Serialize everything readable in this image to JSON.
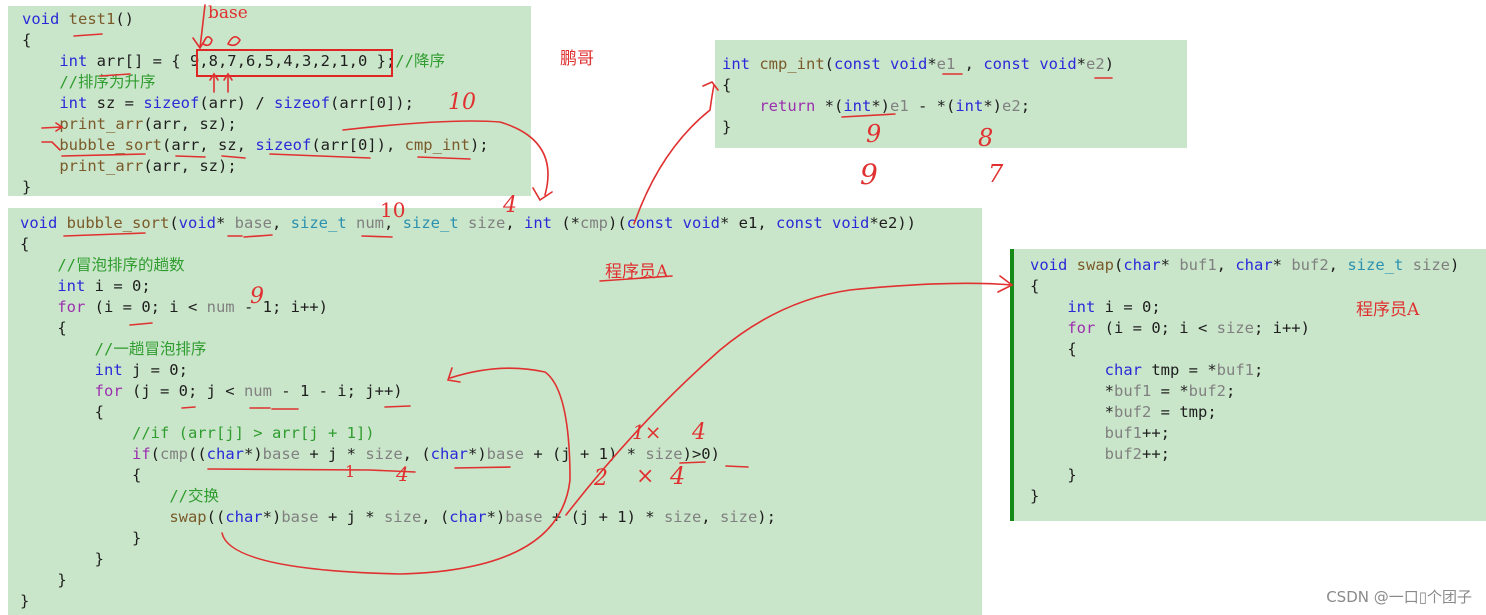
{
  "panels": {
    "test1": {
      "lines": [
        [
          [
            "kw",
            "void "
          ],
          [
            "fn",
            "test1"
          ],
          [
            "",
            "()"
          ]
        ],
        [
          [
            "",
            "{"
          ]
        ],
        [
          [
            "",
            "    "
          ],
          [
            "kw",
            "int "
          ],
          [
            "",
            "arr[] = { 9,8,7,6,5,4,3,2,1,0 };"
          ],
          [
            "cm",
            "//降序"
          ]
        ],
        [
          [
            "",
            "    "
          ],
          [
            "cm",
            "//排序为升序"
          ]
        ],
        [
          [
            "",
            "    "
          ],
          [
            "kw",
            "int "
          ],
          [
            "",
            "sz = "
          ],
          [
            "kw",
            "sizeof"
          ],
          [
            "",
            "(arr) / "
          ],
          [
            "kw",
            "sizeof"
          ],
          [
            "",
            "(arr[0]);"
          ]
        ],
        [
          [
            "",
            "    "
          ],
          [
            "fn",
            "print_arr"
          ],
          [
            "",
            "(arr, sz);"
          ]
        ],
        [
          [
            "",
            "    "
          ],
          [
            "fn",
            "bubble_sort"
          ],
          [
            "",
            "(arr, sz, "
          ],
          [
            "kw",
            "sizeof"
          ],
          [
            "",
            "(arr[0]), "
          ],
          [
            "fn",
            "cmp_int"
          ],
          [
            "",
            ");"
          ]
        ],
        [
          [
            "",
            "    "
          ],
          [
            "fn",
            "print_arr"
          ],
          [
            "",
            "(arr, sz);"
          ]
        ],
        [
          [
            "",
            "}"
          ]
        ]
      ]
    },
    "cmp_int": {
      "lines": [
        [
          [
            "kw",
            "int "
          ],
          [
            "fn",
            "cmp_int"
          ],
          [
            "",
            "("
          ],
          [
            "kw",
            "const void"
          ],
          [
            "",
            "*"
          ],
          [
            "par",
            "e1"
          ],
          [
            "",
            " , "
          ],
          [
            "kw",
            "const void"
          ],
          [
            "",
            "*"
          ],
          [
            "par",
            "e2"
          ],
          [
            "",
            ")"
          ]
        ],
        [
          [
            "",
            "{"
          ]
        ],
        [
          [
            "",
            "    "
          ],
          [
            "ret",
            "return "
          ],
          [
            "",
            "*("
          ],
          [
            "kw",
            "int"
          ],
          [
            "",
            "*)"
          ],
          [
            "par",
            "e1"
          ],
          [
            "",
            " - *("
          ],
          [
            "kw",
            "int"
          ],
          [
            "",
            "*)"
          ],
          [
            "par",
            "e2"
          ],
          [
            "",
            ";"
          ]
        ],
        [
          [
            "",
            "}"
          ]
        ]
      ]
    },
    "bubble_sort": {
      "lines": [
        [
          [
            "kw",
            "void "
          ],
          [
            "fn",
            "bubble_sort"
          ],
          [
            "",
            "("
          ],
          [
            "kw",
            "void"
          ],
          [
            "",
            "* "
          ],
          [
            "par",
            "base"
          ],
          [
            "",
            ", "
          ],
          [
            "ty",
            "size_t "
          ],
          [
            "par",
            "num"
          ],
          [
            "",
            ", "
          ],
          [
            "ty",
            "size_t "
          ],
          [
            "par",
            "size"
          ],
          [
            "",
            ", "
          ],
          [
            "kw",
            "int "
          ],
          [
            "",
            "(*"
          ],
          [
            "par",
            "cmp"
          ],
          [
            "",
            ")("
          ],
          [
            "kw",
            "const void"
          ],
          [
            "",
            "* e1, "
          ],
          [
            "kw",
            "const void"
          ],
          [
            "",
            "*e2))"
          ]
        ],
        [
          [
            "",
            "{"
          ]
        ],
        [
          [
            "",
            "    "
          ],
          [
            "cm",
            "//冒泡排序的趟数"
          ]
        ],
        [
          [
            "",
            "    "
          ],
          [
            "kw",
            "int "
          ],
          [
            "",
            "i = 0;"
          ]
        ],
        [
          [
            "",
            "    "
          ],
          [
            "ctl",
            "for "
          ],
          [
            "",
            "(i = 0; i < "
          ],
          [
            "par",
            "num"
          ],
          [
            "",
            " - 1; i++)"
          ]
        ],
        [
          [
            "",
            "    {"
          ]
        ],
        [
          [
            "",
            "        "
          ],
          [
            "cm",
            "//一趟冒泡排序"
          ]
        ],
        [
          [
            "",
            "        "
          ],
          [
            "kw",
            "int "
          ],
          [
            "",
            "j = 0;"
          ]
        ],
        [
          [
            "",
            "        "
          ],
          [
            "ctl",
            "for "
          ],
          [
            "",
            "(j = 0; j < "
          ],
          [
            "par",
            "num"
          ],
          [
            "",
            " - 1 - i; j++)"
          ]
        ],
        [
          [
            "",
            "        {"
          ]
        ],
        [
          [
            "",
            "            "
          ],
          [
            "cm",
            "//if (arr[j] > arr[j + 1])"
          ]
        ],
        [
          [
            "",
            "            "
          ],
          [
            "ctl",
            "if"
          ],
          [
            "",
            "("
          ],
          [
            "par",
            "cmp"
          ],
          [
            "",
            "(("
          ],
          [
            "kw",
            "char"
          ],
          [
            "",
            "*)"
          ],
          [
            "par",
            "base"
          ],
          [
            "",
            " + j * "
          ],
          [
            "par",
            "size"
          ],
          [
            "",
            ", ("
          ],
          [
            "kw",
            "char"
          ],
          [
            "",
            "*)"
          ],
          [
            "par",
            "base"
          ],
          [
            "",
            " + (j + 1) * "
          ],
          [
            "par",
            "size"
          ],
          [
            "",
            ")>0)"
          ]
        ],
        [
          [
            "",
            "            {"
          ]
        ],
        [
          [
            "",
            "                "
          ],
          [
            "cm",
            "//交换"
          ]
        ],
        [
          [
            "",
            "                "
          ],
          [
            "fn",
            "swap"
          ],
          [
            "",
            "(("
          ],
          [
            "kw",
            "char"
          ],
          [
            "",
            "*)"
          ],
          [
            "par",
            "base"
          ],
          [
            "",
            " + j * "
          ],
          [
            "par",
            "size"
          ],
          [
            "",
            ", ("
          ],
          [
            "kw",
            "char"
          ],
          [
            "",
            "*)"
          ],
          [
            "par",
            "base"
          ],
          [
            "",
            " + (j + 1) * "
          ],
          [
            "par",
            "size"
          ],
          [
            "",
            ", "
          ],
          [
            "par",
            "size"
          ],
          [
            "",
            ");"
          ]
        ],
        [
          [
            "",
            "            }"
          ]
        ],
        [
          [
            "",
            "        }"
          ]
        ],
        [
          [
            "",
            "    }"
          ]
        ],
        [
          [
            "",
            "}"
          ]
        ]
      ]
    },
    "swap": {
      "lines": [
        [
          [
            "kw",
            "void "
          ],
          [
            "fn",
            "swap"
          ],
          [
            "",
            "("
          ],
          [
            "kw",
            "char"
          ],
          [
            "",
            "* "
          ],
          [
            "par",
            "buf1"
          ],
          [
            "",
            ", "
          ],
          [
            "kw",
            "char"
          ],
          [
            "",
            "* "
          ],
          [
            "par",
            "buf2"
          ],
          [
            "",
            ", "
          ],
          [
            "ty",
            "size_t "
          ],
          [
            "par",
            "size"
          ],
          [
            "",
            ")"
          ]
        ],
        [
          [
            "",
            "{"
          ]
        ],
        [
          [
            "",
            "    "
          ],
          [
            "kw",
            "int "
          ],
          [
            "",
            "i = 0;"
          ]
        ],
        [
          [
            "",
            "    "
          ],
          [
            "ctl",
            "for "
          ],
          [
            "",
            "(i = 0; i < "
          ],
          [
            "par",
            "size"
          ],
          [
            "",
            "; i++)"
          ]
        ],
        [
          [
            "",
            "    {"
          ]
        ],
        [
          [
            "",
            "        "
          ],
          [
            "kw",
            "char "
          ],
          [
            "",
            "tmp = *"
          ],
          [
            "par",
            "buf1"
          ],
          [
            "",
            ";"
          ]
        ],
        [
          [
            "",
            "        *"
          ],
          [
            "par",
            "buf1"
          ],
          [
            "",
            " = *"
          ],
          [
            "par",
            "buf2"
          ],
          [
            "",
            ";"
          ]
        ],
        [
          [
            "",
            "        *"
          ],
          [
            "par",
            "buf2"
          ],
          [
            "",
            " = tmp;"
          ]
        ],
        [
          [
            "",
            "        "
          ],
          [
            "par",
            "buf1"
          ],
          [
            "",
            "++;"
          ]
        ],
        [
          [
            "",
            "        "
          ],
          [
            "par",
            "buf2"
          ],
          [
            "",
            "++;"
          ]
        ],
        [
          [
            "",
            "    }"
          ]
        ],
        [
          [
            "",
            "}"
          ]
        ]
      ]
    }
  },
  "annotations": {
    "base_label": "base",
    "pengge": "鹏哥",
    "programmer_a_1": "程序员A",
    "programmer_a_2": "程序员A",
    "sz_value": "10",
    "num_value": "10",
    "size_value": "4",
    "num_minus_one": "9",
    "e1_value_top": "9",
    "e2_value_top": "8",
    "e1_value_bottom": "9",
    "e2_value_bottom": "7",
    "j_value": "1",
    "size_4_a": "4",
    "j_plus_one": "2",
    "one_x": "1×",
    "size_4_b": "4",
    "two_x": "×",
    "size_4_c": "4"
  },
  "watermark": "CSDN @一口▯个团子",
  "colors": {
    "panel_bg": "#cae6ca",
    "annotation_red": "#e03030",
    "keyword_blue": "#2a2ad8",
    "comment_green": "#2f9c2f",
    "change_bar_green": "#168a16"
  }
}
